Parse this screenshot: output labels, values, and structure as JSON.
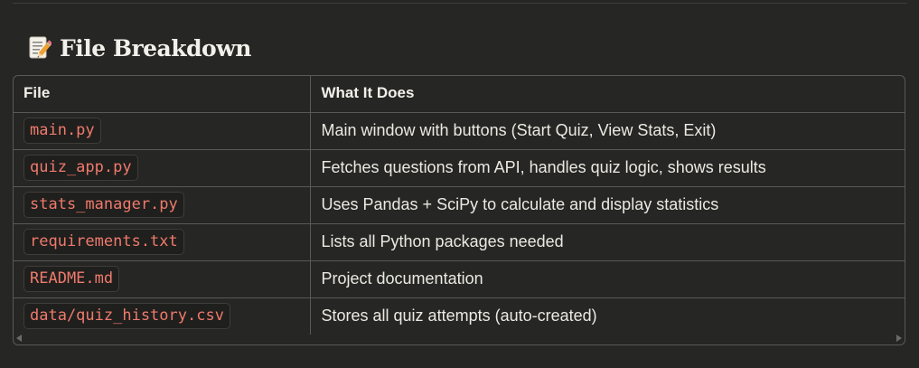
{
  "section": {
    "icon": "memo-icon",
    "title": "File Breakdown"
  },
  "table": {
    "headers": [
      "File",
      "What It Does"
    ],
    "rows": [
      {
        "file": "main.py",
        "description": "Main window with buttons (Start Quiz, View Stats, Exit)"
      },
      {
        "file": "quiz_app.py",
        "description": "Fetches questions from API, handles quiz logic, shows results"
      },
      {
        "file": "stats_manager.py",
        "description": "Uses Pandas + SciPy to calculate and display statistics"
      },
      {
        "file": "requirements.txt",
        "description": "Lists all Python packages needed"
      },
      {
        "file": "README.md",
        "description": "Project documentation"
      },
      {
        "file": "data/quiz_history.csv",
        "description": "Stores all quiz attempts (auto-created)"
      }
    ]
  },
  "colors": {
    "background": "#262624",
    "code_text": "#ef7a6c",
    "border": "#5a5955"
  }
}
